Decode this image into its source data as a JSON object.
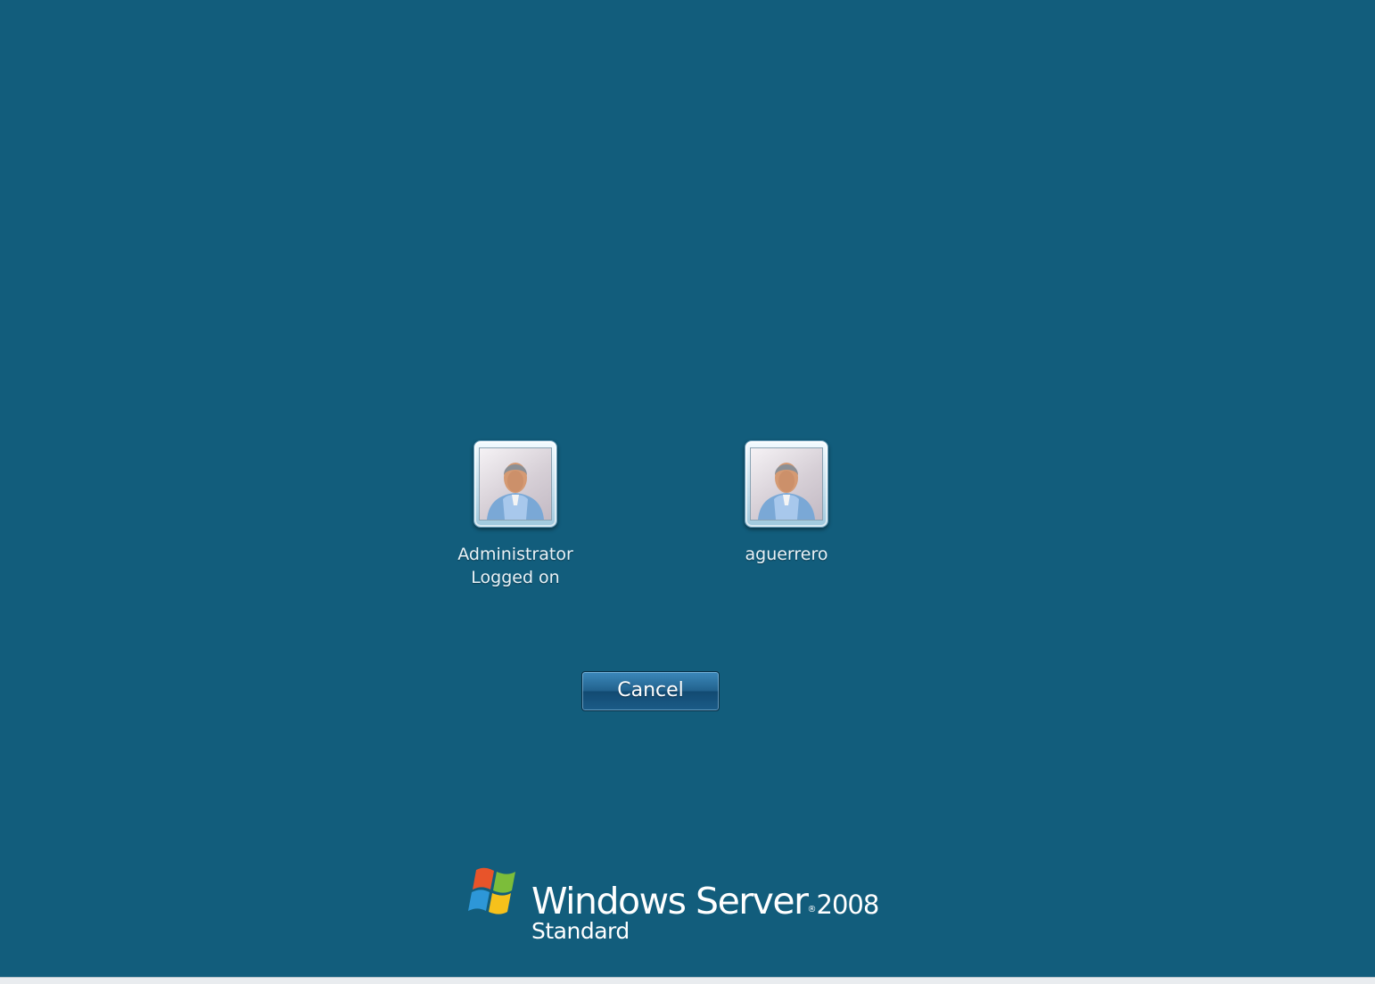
{
  "users": [
    {
      "name": "Administrator",
      "status": "Logged on"
    },
    {
      "name": "aguerrero",
      "status": ""
    }
  ],
  "cancel_button": {
    "label": "Cancel"
  },
  "branding": {
    "product": "Windows Server",
    "registered_mark": "®",
    "version": "2008",
    "edition": "Standard",
    "logo_icon": "windows-flag-icon"
  },
  "colors": {
    "background": "#125d7c",
    "text": "#e9f2f7",
    "button_gradient_top": "#3c89bb",
    "button_gradient_bottom": "#124a72"
  }
}
